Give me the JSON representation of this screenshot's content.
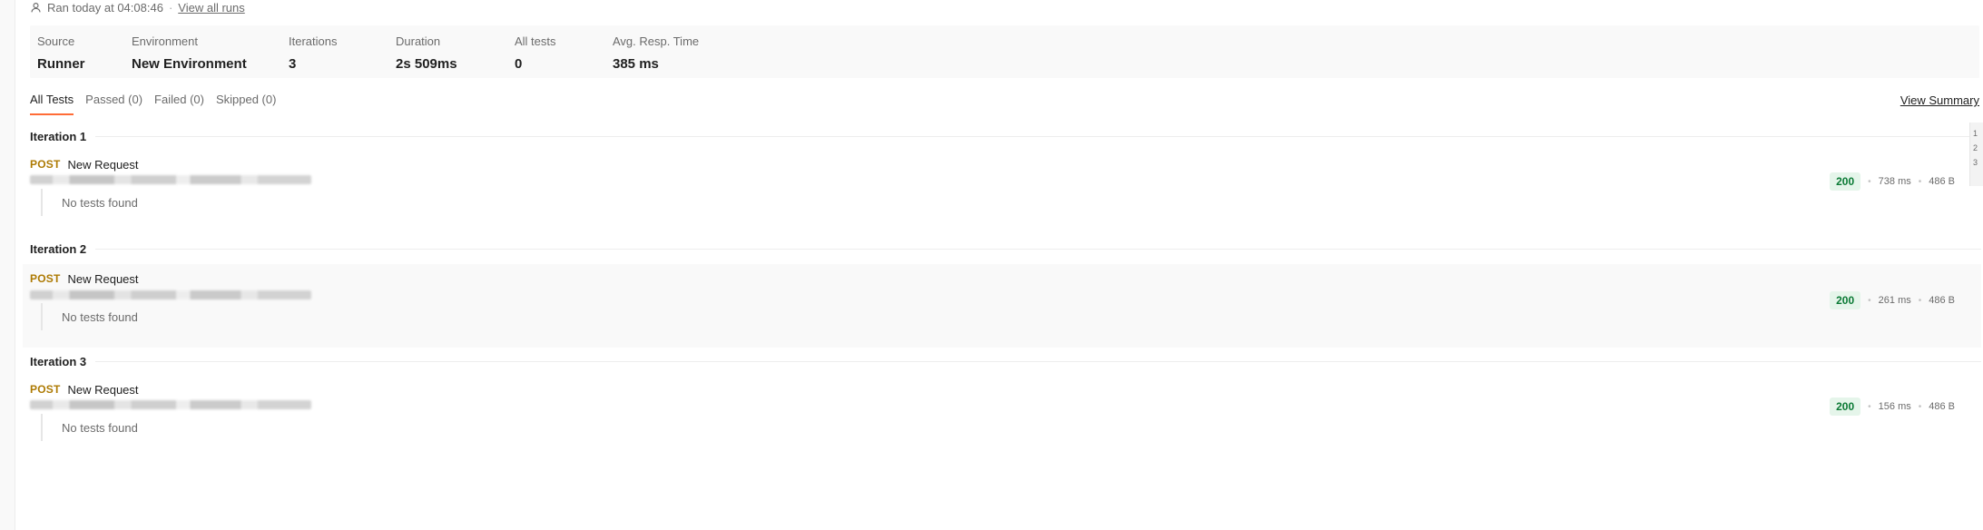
{
  "header": {
    "ran_text": "Ran today at 04:08:46",
    "separator": "·",
    "view_all_runs": "View all runs"
  },
  "summary": [
    {
      "label": "Source",
      "value": "Runner"
    },
    {
      "label": "Environment",
      "value": "New Environment"
    },
    {
      "label": "Iterations",
      "value": "3"
    },
    {
      "label": "Duration",
      "value": "2s 509ms"
    },
    {
      "label": "All tests",
      "value": "0"
    },
    {
      "label": "Avg. Resp. Time",
      "value": "385 ms"
    }
  ],
  "tabs": [
    {
      "label": "All Tests",
      "active": true
    },
    {
      "label": "Passed (0)",
      "active": false
    },
    {
      "label": "Failed (0)",
      "active": false
    },
    {
      "label": "Skipped (0)",
      "active": false
    }
  ],
  "view_summary": "View Summary",
  "iterations": [
    {
      "title": "Iteration 1",
      "method": "POST",
      "name": "New Request",
      "tests_text": "No tests found",
      "status": "200",
      "time": "738 ms",
      "size": "486 B"
    },
    {
      "title": "Iteration 2",
      "method": "POST",
      "name": "New Request",
      "tests_text": "No tests found",
      "status": "200",
      "time": "261 ms",
      "size": "486 B"
    },
    {
      "title": "Iteration 3",
      "method": "POST",
      "name": "New Request",
      "tests_text": "No tests found",
      "status": "200",
      "time": "156 ms",
      "size": "486 B"
    }
  ],
  "meta_separator": "•",
  "right_rail": [
    "1",
    "2",
    "3"
  ],
  "colors": {
    "accent": "#ff6c37",
    "method_post": "#ad7a03",
    "status_ok_bg": "#e5f5ea",
    "status_ok_text": "#0b7a35"
  }
}
